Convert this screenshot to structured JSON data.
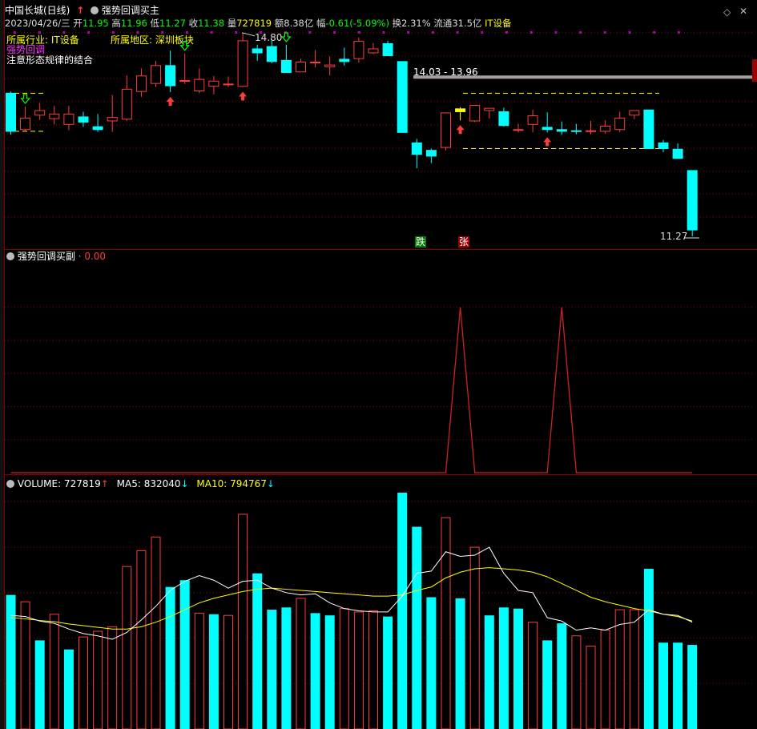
{
  "header": {
    "stock_name": "中国长城(日线)",
    "indicator_name": "强势回调买主",
    "date": "2023/04/26/三",
    "open_label": "开",
    "open": "11.95",
    "high_label": "高",
    "high": "11.96",
    "low_label": "低",
    "low": "11.27",
    "close_label": "收",
    "close": "11.38",
    "volume_label": "量",
    "volume": "727819",
    "amount_label": "额",
    "amount": "8.38亿",
    "change_label": "幅",
    "change": "-0.61(-5.09%)",
    "turnover_label": "换",
    "turnover": "2.31%",
    "float_label": "流通",
    "float_cap": "31.5亿",
    "sector": "IT设备"
  },
  "info": {
    "industry": "所属行业: IT设备",
    "region": "所属地区: 深圳板块",
    "strong_pullback": "强势回调",
    "note": "注意形态规律的结合"
  },
  "colors": {
    "up": "#ff3c3c",
    "down": "#00ffff",
    "ma5": "#ffffff",
    "ma10": "#ffff00",
    "grid": "#8a0000",
    "highlight": "#ffff00",
    "resistance": "#a0a0a0"
  },
  "main_chart": {
    "high_annotation": "14.80",
    "low_annotation": "11.27",
    "range_annotation": "14.03 - 13.96",
    "fall_badge": "跌",
    "rise_badge": "张"
  },
  "sub_panel": {
    "title": "强势回调买副",
    "value": "0.00"
  },
  "volume_panel": {
    "label": "VOLUME: 727819",
    "ma5_label": "MA5: 832040",
    "ma10_label": "MA10: 794767"
  },
  "chart_data": [
    {
      "type": "candlestick",
      "ohlc": [
        [
          13.75,
          13.78,
          13.03,
          13.09
        ],
        [
          13.12,
          13.52,
          13.08,
          13.32
        ],
        [
          13.37,
          13.58,
          13.29,
          13.45
        ],
        [
          13.31,
          13.53,
          13.21,
          13.39
        ],
        [
          13.21,
          13.53,
          13.11,
          13.39
        ],
        [
          13.34,
          13.43,
          13.17,
          13.25
        ],
        [
          13.17,
          13.39,
          13.08,
          13.12
        ],
        [
          13.27,
          13.72,
          13.08,
          13.33
        ],
        [
          13.3,
          14.06,
          13.27,
          13.82
        ],
        [
          13.78,
          14.18,
          13.69,
          14.05
        ],
        [
          13.92,
          14.31,
          13.86,
          14.23
        ],
        [
          14.23,
          14.49,
          13.77,
          13.88
        ],
        [
          13.97,
          14.44,
          13.91,
          13.97
        ],
        [
          13.79,
          14.18,
          13.75,
          13.99
        ],
        [
          13.87,
          14.05,
          13.73,
          13.96
        ],
        [
          13.9,
          14.04,
          13.86,
          13.91
        ],
        [
          13.87,
          14.8,
          13.86,
          14.66
        ],
        [
          14.52,
          14.59,
          14.31,
          14.45
        ],
        [
          14.56,
          14.66,
          14.27,
          14.3
        ],
        [
          14.32,
          14.59,
          14.18,
          14.11
        ],
        [
          14.12,
          14.35,
          14.12,
          14.29
        ],
        [
          14.28,
          14.5,
          14.2,
          14.29
        ],
        [
          14.21,
          14.39,
          14.06,
          14.24
        ],
        [
          14.34,
          14.54,
          14.23,
          14.3
        ],
        [
          14.35,
          14.72,
          14.28,
          14.65
        ],
        [
          14.45,
          14.62,
          14.43,
          14.52
        ],
        [
          14.61,
          14.66,
          14.41,
          14.4
        ],
        [
          14.3,
          14.3,
          13.06,
          13.07
        ],
        [
          12.89,
          12.96,
          12.45,
          12.69
        ],
        [
          12.76,
          12.79,
          12.54,
          12.66
        ],
        [
          12.81,
          13.39,
          12.76,
          13.41
        ],
        [
          13.43,
          13.51,
          13.28,
          13.48
        ],
        [
          13.27,
          13.5,
          13.25,
          13.54
        ],
        [
          13.45,
          13.47,
          13.31,
          13.49
        ],
        [
          13.43,
          13.5,
          13.17,
          13.19
        ],
        [
          13.12,
          13.22,
          13.07,
          13.12
        ],
        [
          13.21,
          13.46,
          13.07,
          13.36
        ],
        [
          13.16,
          13.42,
          13.07,
          13.12
        ],
        [
          13.12,
          13.26,
          13.03,
          13.09
        ],
        [
          13.1,
          13.22,
          13.04,
          13.09
        ],
        [
          13.09,
          13.27,
          13.04,
          13.1
        ],
        [
          13.09,
          13.28,
          13.05,
          13.18
        ],
        [
          13.12,
          13.43,
          13.08,
          13.32
        ],
        [
          13.37,
          13.45,
          13.3,
          13.45
        ],
        [
          13.46,
          13.46,
          12.79,
          12.79
        ],
        [
          12.89,
          12.94,
          12.73,
          12.79
        ],
        [
          12.78,
          12.88,
          12.61,
          12.62
        ],
        [
          12.41,
          12.41,
          11.27,
          11.38
        ]
      ],
      "ylim": [
        11.2,
        14.95
      ]
    },
    {
      "type": "line",
      "name": "强势回调买副",
      "values": [
        0,
        0,
        0,
        0,
        0,
        0,
        0,
        0,
        0,
        0,
        0,
        0,
        0,
        0,
        0,
        0,
        0,
        0,
        0,
        0,
        0,
        0,
        0,
        0,
        0,
        0,
        0,
        0,
        0,
        0,
        0,
        1,
        0,
        0,
        0,
        0,
        0,
        0,
        1,
        0,
        0,
        0,
        0,
        0,
        0,
        0,
        0,
        0
      ],
      "ylim": [
        0,
        1.25
      ]
    },
    {
      "type": "bar",
      "name": "VOLUME",
      "values": [
        1180000,
        1120000,
        780000,
        1010000,
        700000,
        810000,
        860000,
        900000,
        1430000,
        1570000,
        1690000,
        1250000,
        1310000,
        1020000,
        1010000,
        1000000,
        1890000,
        1370000,
        1050000,
        1070000,
        1150000,
        1020000,
        1000000,
        1060000,
        1030000,
        1040000,
        990000,
        2080000,
        1780000,
        1160000,
        1860000,
        1150000,
        1600000,
        1000000,
        1070000,
        1060000,
        940000,
        780000,
        930000,
        820000,
        730000,
        870000,
        1050000,
        1050000,
        1410000,
        760000,
        760000,
        740000
      ],
      "up": [
        false,
        true,
        false,
        true,
        false,
        true,
        true,
        true,
        true,
        true,
        true,
        false,
        false,
        true,
        false,
        true,
        true,
        false,
        false,
        false,
        true,
        false,
        false,
        true,
        true,
        true,
        false,
        false,
        false,
        false,
        true,
        false,
        true,
        false,
        false,
        false,
        true,
        false,
        false,
        true,
        true,
        true,
        true,
        true,
        false,
        false,
        false,
        false
      ],
      "ma5": [
        1000000,
        990000,
        950000,
        930000,
        880000,
        840000,
        820000,
        790000,
        850000,
        960000,
        1080000,
        1220000,
        1300000,
        1350000,
        1310000,
        1240000,
        1300000,
        1310000,
        1240000,
        1200000,
        1180000,
        1190000,
        1110000,
        1060000,
        1040000,
        1030000,
        1030000,
        1170000,
        1370000,
        1390000,
        1560000,
        1520000,
        1530000,
        1600000,
        1370000,
        1220000,
        1200000,
        980000,
        950000,
        870000,
        890000,
        870000,
        920000,
        940000,
        1050000,
        1010000,
        1000000,
        940000
      ],
      "ma10": [
        980000,
        970000,
        955000,
        945000,
        925000,
        910000,
        895000,
        880000,
        880000,
        900000,
        940000,
        990000,
        1050000,
        1110000,
        1150000,
        1180000,
        1210000,
        1230000,
        1240000,
        1230000,
        1220000,
        1210000,
        1200000,
        1190000,
        1180000,
        1170000,
        1170000,
        1180000,
        1220000,
        1250000,
        1330000,
        1380000,
        1410000,
        1420000,
        1410000,
        1400000,
        1380000,
        1340000,
        1280000,
        1220000,
        1160000,
        1120000,
        1090000,
        1060000,
        1040000,
        1010000,
        990000,
        950000
      ],
      "ylim": [
        0,
        2200000
      ]
    }
  ]
}
